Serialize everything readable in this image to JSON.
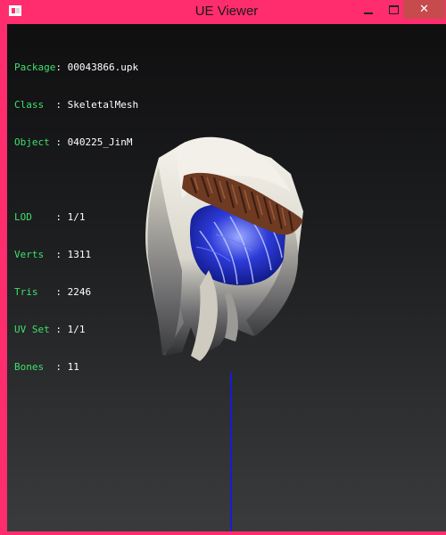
{
  "window": {
    "title": "UE Viewer",
    "controls": {
      "minimize": "—",
      "maximize": "□",
      "close": "✕"
    }
  },
  "info": {
    "package": {
      "key": "Package",
      "value": "00043866.upk"
    },
    "class": {
      "key": "Class  ",
      "value": "SkeletalMesh"
    },
    "object": {
      "key": "Object ",
      "value": "040225_JinM"
    },
    "lod": {
      "key": "LOD    ",
      "value": "1/1"
    },
    "verts": {
      "key": "Verts  ",
      "value": "1311"
    },
    "tris": {
      "key": "Tris   ",
      "value": "2246"
    },
    "uvset": {
      "key": "UV Set ",
      "value": "1/1"
    },
    "bones": {
      "key": "Bones  ",
      "value": "11"
    },
    "separator": ": "
  },
  "colors": {
    "title_bar": "#ff2d6e",
    "close_button": "#c74a4d",
    "info_key": "#3ee06b",
    "info_value": "#ffffff",
    "axis": "#1a1ad6"
  }
}
